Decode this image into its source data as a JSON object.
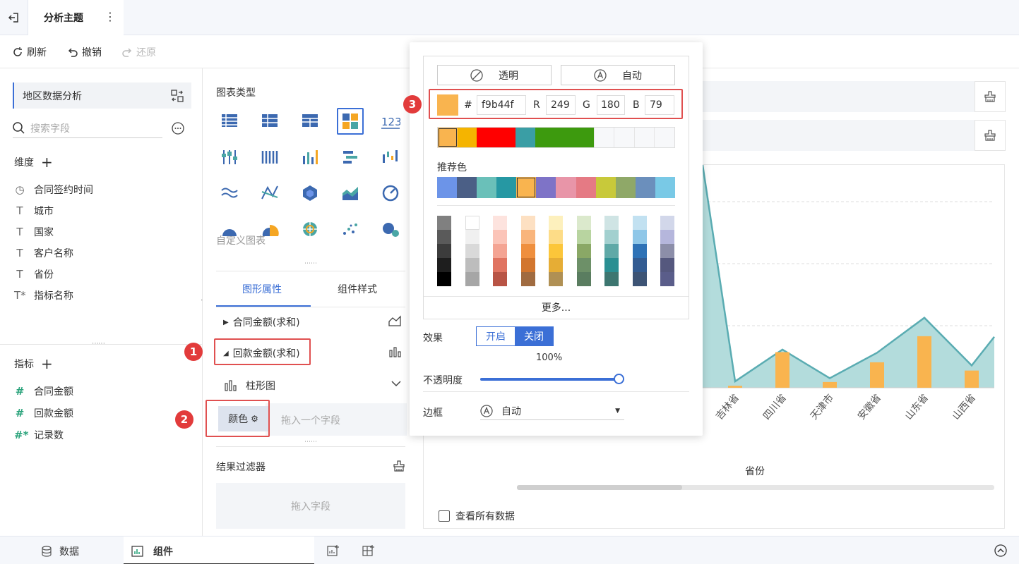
{
  "header": {
    "theme_title": "分析主题",
    "more": "⋮"
  },
  "toolbar": {
    "refresh": "刷新",
    "undo": "撤销",
    "redo": "还原"
  },
  "left_panel": {
    "dataset_name": "地区数据分析",
    "search_placeholder": "搜索字段",
    "dimensions_title": "维度",
    "dimensions": [
      {
        "icon": "clock-icon",
        "label": "合同签约时间"
      },
      {
        "icon": "text-icon",
        "label": "城市"
      },
      {
        "icon": "text-icon",
        "label": "国家"
      },
      {
        "icon": "text-icon",
        "label": "客户名称"
      },
      {
        "icon": "text-icon",
        "label": "省份"
      },
      {
        "icon": "text-star-icon",
        "label": "指标名称"
      }
    ],
    "measures_title": "指标",
    "measures": [
      {
        "icon": "hash-icon",
        "label": "合同金额"
      },
      {
        "icon": "hash-icon",
        "label": "回款金额"
      },
      {
        "icon": "hash-star-icon",
        "label": "记录数"
      }
    ]
  },
  "chart_panel": {
    "title": "图表类型",
    "custom_label": "自定义图表",
    "tab_shape": "图形属性",
    "tab_style": "组件样式",
    "series1": "合同金额(求和)",
    "series2": "回款金额(求和)",
    "chart_type": "柱形图",
    "color_label": "颜色",
    "drop_hint": "拖入一个字段",
    "filter_title": "结果过滤器",
    "filter_drop": "拖入字段"
  },
  "color_picker": {
    "transparent": "透明",
    "auto": "自动",
    "hash": "#",
    "hex": "f9b44f",
    "r_label": "R",
    "r": "249",
    "g_label": "G",
    "g": "180",
    "b_label": "B",
    "b": "79",
    "recent_colors": [
      "#f9b44f",
      "#f5b400",
      "#ff0000",
      "#ff0000",
      "#3a9ea5",
      "#3d9a0e",
      "#3d9a0e",
      "#3d9a0e",
      "#f7f8fa",
      "#f7f8fa",
      "#f7f8fa",
      "#f7f8fa"
    ],
    "recommend_title": "推荐色",
    "recommend_colors": [
      "#6c94e8",
      "#4b5f86",
      "#6ac0b9",
      "#2698a3",
      "#f9b44f",
      "#7e73c7",
      "#e895a8",
      "#e57a84",
      "#c8c93a",
      "#8fa868",
      "#6b8fbc",
      "#79c9e6"
    ],
    "palette_columns": [
      [
        "#808080",
        "#5a5a5a",
        "#3c3c3c",
        "#1e1e1e",
        "#000000"
      ],
      [
        "#ffffff",
        "#f0f0f0",
        "#d9d9d9",
        "#bdbdbd",
        "#a6a6a6"
      ],
      [
        "#fde3de",
        "#fbc4b8",
        "#f4a493",
        "#e07461",
        "#b85445"
      ],
      [
        "#fde0c2",
        "#f9b57c",
        "#ef8f3e",
        "#d2762e",
        "#a06b40"
      ],
      [
        "#fdf0bd",
        "#fddc87",
        "#fcc63a",
        "#e6ad35",
        "#b09054"
      ],
      [
        "#dbe9cc",
        "#b8d4a0",
        "#8aa866",
        "#6d9068",
        "#5a7d60"
      ],
      [
        "#cfe4e4",
        "#a2d0cf",
        "#5fa9a7",
        "#2a8f92",
        "#3d7670"
      ],
      [
        "#c2e1f1",
        "#8fc7e8",
        "#2e72b6",
        "#335c92",
        "#3d5475"
      ],
      [
        "#d2d7ea",
        "#b5b6dc",
        "#8c8ea9",
        "#55587e",
        "#5a5d8a"
      ]
    ],
    "more": "更多...",
    "effect_label": "效果",
    "effect_on": "开启",
    "effect_off": "关闭",
    "opacity_value": "100%",
    "opacity_label": "不透明度",
    "opacity": 1.0,
    "border_label": "边框",
    "border_value": "自动"
  },
  "chart": {
    "xlabel": "省份",
    "view_all": "查看所有数据"
  },
  "chart_data": {
    "type": "bar",
    "categories": [
      "吉林省",
      "四川省",
      "天津市",
      "安徽省",
      "山东省",
      "山西省"
    ],
    "series": [
      {
        "values": [
          0.3,
          5.6,
          0.9,
          4.0,
          8.1,
          2.7
        ],
        "color": "#f9b44f",
        "type": "bar"
      },
      {
        "values": [
          1,
          6,
          1.5,
          5.5,
          11,
          3.5
        ],
        "color": "#5aacb2",
        "type": "area"
      }
    ],
    "ylim": [
      0,
      35
    ]
  },
  "bottombar": {
    "data": "数据",
    "component": "组件"
  },
  "badges": [
    "1",
    "2",
    "3"
  ]
}
